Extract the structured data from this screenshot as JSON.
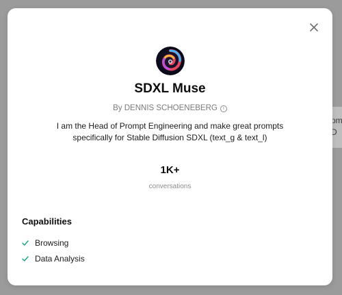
{
  "backdrop": {
    "partial_text": "pmp\nD"
  },
  "modal": {
    "close_icon": "close-icon",
    "avatar_icon": "swirl-avatar",
    "title": "SDXL Muse",
    "author": "By DENNIS SCHOENEBERG",
    "author_info_icon": "info-icon",
    "description": "I am the Head of Prompt Engineering and make great prompts specifically for Stable Diffusion SDXL (text_g & text_l)",
    "stats": {
      "value": "1K+",
      "label": "conversations"
    },
    "capabilities": {
      "heading": "Capabilities",
      "items": [
        {
          "label": "Browsing",
          "icon": "check-icon"
        },
        {
          "label": "Data Analysis",
          "icon": "check-icon"
        }
      ]
    }
  },
  "colors": {
    "backdrop": "#9b9b9b",
    "card": "#ffffff",
    "check": "#10a37f",
    "muted_text": "#7a7a7a"
  }
}
